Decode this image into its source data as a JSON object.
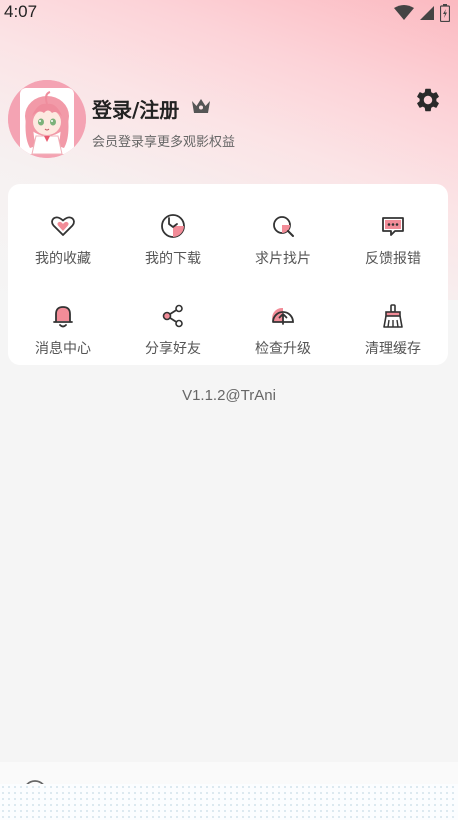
{
  "status_bar": {
    "time": "4:07"
  },
  "profile": {
    "title": "登录/注册",
    "subtitle": "会员登录享更多观影权益"
  },
  "menu": {
    "items": [
      {
        "label": "我的收藏",
        "icon": "heart-icon"
      },
      {
        "label": "我的下载",
        "icon": "download-icon"
      },
      {
        "label": "求片找片",
        "icon": "search-icon"
      },
      {
        "label": "反馈报错",
        "icon": "feedback-icon"
      },
      {
        "label": "消息中心",
        "icon": "bell-icon"
      },
      {
        "label": "分享好友",
        "icon": "share-icon"
      },
      {
        "label": "检查升级",
        "icon": "upgrade-icon"
      },
      {
        "label": "清理缓存",
        "icon": "broom-icon"
      }
    ]
  },
  "version": "V1.1.2@TrAni",
  "colors": {
    "accent": "#f28c98",
    "card": "#ffffff",
    "background": "#f5f5f5"
  }
}
